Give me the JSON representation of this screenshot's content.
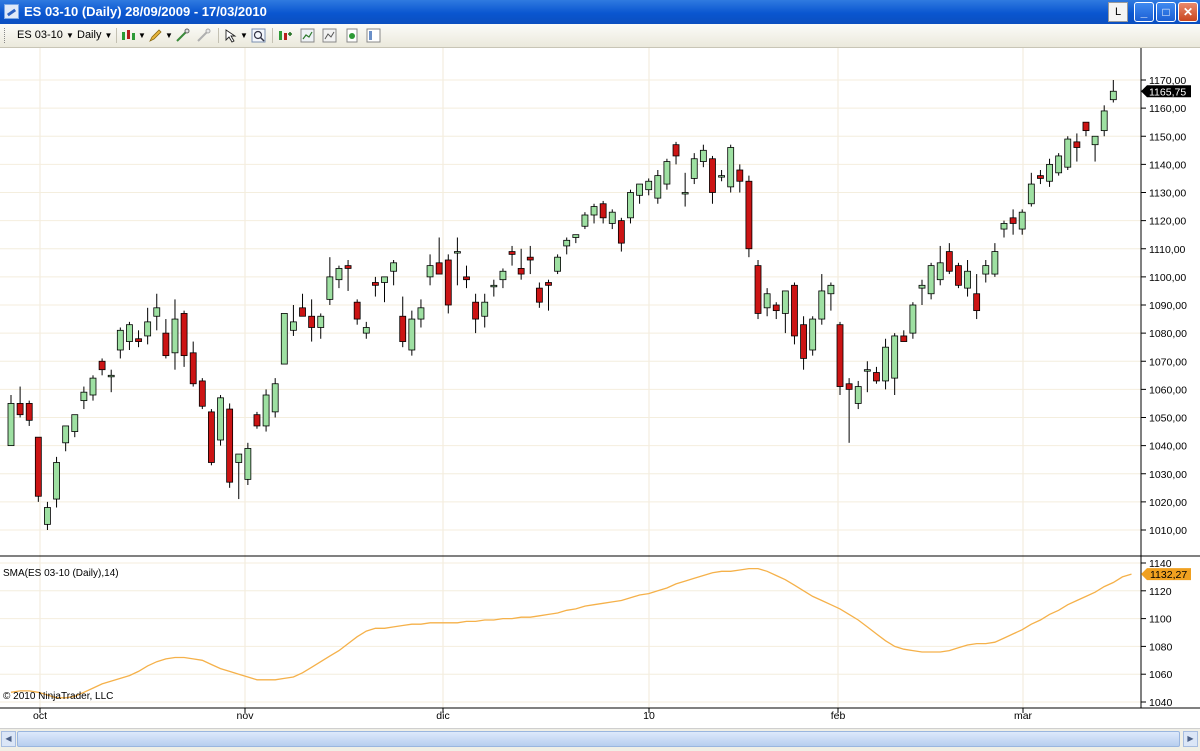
{
  "window": {
    "title": "ES 03-10 (Daily)  28/09/2009 - 17/03/2010",
    "l_button": "L",
    "minimize": "_",
    "maximize": "□",
    "close": "✕"
  },
  "toolbar": {
    "instrument": "ES 03-10",
    "interval": "Daily",
    "icons": [
      "bar-type-icon",
      "pencil-draw-icon",
      "crosshair-icon",
      "stop-icon",
      "pointer-icon",
      "zoom-icon",
      "strategy-icon",
      "indicator-icon",
      "chart-properties-icon",
      "data-box-icon",
      "panel-icon"
    ]
  },
  "colors": {
    "up": "#9ee0a2",
    "down": "#cc1414",
    "sma": "#f5b14a",
    "last_price_bg": "#000000",
    "sma_label_bg": "#f0a020"
  },
  "price_panel": {
    "last_price_label": "1165,75",
    "y_ticks": [
      "1170,00",
      "1160,00",
      "1150,00",
      "1140,00",
      "1130,00",
      "1120,00",
      "1110,00",
      "1100,00",
      "1090,00",
      "1080,00",
      "1070,00",
      "1060,00",
      "1050,00",
      "1040,00",
      "1030,00",
      "1020,00",
      "1010,00"
    ]
  },
  "indicator_panel": {
    "title": "SMA(ES 03-10 (Daily),14)",
    "last_value_label": "1132,27",
    "y_ticks": [
      "1140",
      "1120",
      "1100",
      "1080",
      "1060",
      "1040"
    ]
  },
  "x_axis_labels": [
    "oct",
    "nov",
    "dic",
    "10",
    "feb",
    "mar"
  ],
  "copyright": "© 2010 NinjaTrader, LLC",
  "chart_data": {
    "type": "candlestick",
    "title": "ES 03-10 (Daily)",
    "date_range": "28/09/2009 - 17/03/2010",
    "ylim": [
      1003,
      1173
    ],
    "x_labels": [
      "oct",
      "nov",
      "dic",
      "10",
      "feb",
      "mar"
    ],
    "candles": [
      {
        "o": 1040,
        "h": 1058,
        "l": 1040,
        "c": 1055
      },
      {
        "o": 1055,
        "h": 1061,
        "l": 1050,
        "c": 1051
      },
      {
        "o": 1055,
        "h": 1056,
        "l": 1047,
        "c": 1049
      },
      {
        "o": 1043,
        "h": 1043,
        "l": 1020,
        "c": 1022
      },
      {
        "o": 1012,
        "h": 1020,
        "l": 1010,
        "c": 1018
      },
      {
        "o": 1021,
        "h": 1036,
        "l": 1018,
        "c": 1034
      },
      {
        "o": 1041,
        "h": 1047,
        "l": 1038,
        "c": 1047
      },
      {
        "o": 1045,
        "h": 1051,
        "l": 1043,
        "c": 1051
      },
      {
        "o": 1056,
        "h": 1061,
        "l": 1053,
        "c": 1059
      },
      {
        "o": 1058,
        "h": 1065,
        "l": 1056,
        "c": 1064
      },
      {
        "o": 1070,
        "h": 1071,
        "l": 1065,
        "c": 1067
      },
      {
        "o": 1065,
        "h": 1067,
        "l": 1059,
        "c": 1065
      },
      {
        "o": 1074,
        "h": 1082,
        "l": 1071,
        "c": 1081
      },
      {
        "o": 1077,
        "h": 1084,
        "l": 1074,
        "c": 1083
      },
      {
        "o": 1078,
        "h": 1081,
        "l": 1075,
        "c": 1077
      },
      {
        "o": 1079,
        "h": 1089,
        "l": 1076,
        "c": 1084
      },
      {
        "o": 1086,
        "h": 1094,
        "l": 1081,
        "c": 1089
      },
      {
        "o": 1080,
        "h": 1085,
        "l": 1071,
        "c": 1072
      },
      {
        "o": 1073,
        "h": 1092,
        "l": 1067,
        "c": 1085
      },
      {
        "o": 1087,
        "h": 1088,
        "l": 1068,
        "c": 1072
      },
      {
        "o": 1073,
        "h": 1077,
        "l": 1061,
        "c": 1062
      },
      {
        "o": 1063,
        "h": 1064,
        "l": 1053,
        "c": 1054
      },
      {
        "o": 1052,
        "h": 1053,
        "l": 1033,
        "c": 1034
      },
      {
        "o": 1042,
        "h": 1058,
        "l": 1040,
        "c": 1057
      },
      {
        "o": 1053,
        "h": 1055,
        "l": 1025,
        "c": 1027
      },
      {
        "o": 1034,
        "h": 1037,
        "l": 1021,
        "c": 1037
      },
      {
        "o": 1028,
        "h": 1041,
        "l": 1026,
        "c": 1039
      },
      {
        "o": 1051,
        "h": 1052,
        "l": 1046,
        "c": 1047
      },
      {
        "o": 1047,
        "h": 1060,
        "l": 1045,
        "c": 1058
      },
      {
        "o": 1052,
        "h": 1064,
        "l": 1050,
        "c": 1062
      },
      {
        "o": 1069,
        "h": 1087,
        "l": 1069,
        "c": 1087
      },
      {
        "o": 1081,
        "h": 1090,
        "l": 1079,
        "c": 1084
      },
      {
        "o": 1089,
        "h": 1094,
        "l": 1086,
        "c": 1086
      },
      {
        "o": 1086,
        "h": 1092,
        "l": 1077,
        "c": 1082
      },
      {
        "o": 1082,
        "h": 1087,
        "l": 1078,
        "c": 1086
      },
      {
        "o": 1092,
        "h": 1107,
        "l": 1090,
        "c": 1100
      },
      {
        "o": 1099,
        "h": 1104,
        "l": 1096,
        "c": 1103
      },
      {
        "o": 1104,
        "h": 1106,
        "l": 1095,
        "c": 1103
      },
      {
        "o": 1091,
        "h": 1092,
        "l": 1083,
        "c": 1085
      },
      {
        "o": 1080,
        "h": 1084,
        "l": 1078,
        "c": 1082
      },
      {
        "o": 1098,
        "h": 1100,
        "l": 1093,
        "c": 1097
      },
      {
        "o": 1098,
        "h": 1100,
        "l": 1091,
        "c": 1100
      },
      {
        "o": 1102,
        "h": 1106,
        "l": 1097,
        "c": 1105
      },
      {
        "o": 1086,
        "h": 1093,
        "l": 1075,
        "c": 1077
      },
      {
        "o": 1074,
        "h": 1088,
        "l": 1072,
        "c": 1085
      },
      {
        "o": 1085,
        "h": 1092,
        "l": 1082,
        "c": 1089
      },
      {
        "o": 1100,
        "h": 1108,
        "l": 1097,
        "c": 1104
      },
      {
        "o": 1105,
        "h": 1114,
        "l": 1101,
        "c": 1101
      },
      {
        "o": 1106,
        "h": 1108,
        "l": 1087,
        "c": 1090
      },
      {
        "o": 1109,
        "h": 1114,
        "l": 1097,
        "c": 1109
      },
      {
        "o": 1100,
        "h": 1104,
        "l": 1096,
        "c": 1099
      },
      {
        "o": 1091,
        "h": 1094,
        "l": 1080,
        "c": 1085
      },
      {
        "o": 1086,
        "h": 1094,
        "l": 1082,
        "c": 1091
      },
      {
        "o": 1097,
        "h": 1099,
        "l": 1093,
        "c": 1097
      },
      {
        "o": 1099,
        "h": 1103,
        "l": 1096,
        "c": 1102
      },
      {
        "o": 1109,
        "h": 1111,
        "l": 1104,
        "c": 1108
      },
      {
        "o": 1103,
        "h": 1110,
        "l": 1099,
        "c": 1101
      },
      {
        "o": 1107,
        "h": 1111,
        "l": 1101,
        "c": 1106
      },
      {
        "o": 1096,
        "h": 1098,
        "l": 1089,
        "c": 1091
      },
      {
        "o": 1098,
        "h": 1099,
        "l": 1088,
        "c": 1097
      },
      {
        "o": 1102,
        "h": 1108,
        "l": 1101,
        "c": 1107
      },
      {
        "o": 1111,
        "h": 1114,
        "l": 1108,
        "c": 1113
      },
      {
        "o": 1114,
        "h": 1115,
        "l": 1112,
        "c": 1115
      },
      {
        "o": 1118,
        "h": 1123,
        "l": 1117,
        "c": 1122
      },
      {
        "o": 1122,
        "h": 1126,
        "l": 1119,
        "c": 1125
      },
      {
        "o": 1126,
        "h": 1127,
        "l": 1119,
        "c": 1121
      },
      {
        "o": 1119,
        "h": 1124,
        "l": 1117,
        "c": 1123
      },
      {
        "o": 1120,
        "h": 1121,
        "l": 1109,
        "c": 1112
      },
      {
        "o": 1121,
        "h": 1131,
        "l": 1119,
        "c": 1130
      },
      {
        "o": 1129,
        "h": 1133,
        "l": 1126,
        "c": 1133
      },
      {
        "o": 1131,
        "h": 1135,
        "l": 1129,
        "c": 1134
      },
      {
        "o": 1128,
        "h": 1138,
        "l": 1126,
        "c": 1136
      },
      {
        "o": 1133,
        "h": 1142,
        "l": 1131,
        "c": 1141
      },
      {
        "o": 1147,
        "h": 1148,
        "l": 1140,
        "c": 1143
      },
      {
        "o": 1130,
        "h": 1137,
        "l": 1125,
        "c": 1130
      },
      {
        "o": 1135,
        "h": 1144,
        "l": 1133,
        "c": 1142
      },
      {
        "o": 1141,
        "h": 1147,
        "l": 1139,
        "c": 1145
      },
      {
        "o": 1142,
        "h": 1143,
        "l": 1126,
        "c": 1130
      },
      {
        "o": 1136,
        "h": 1138,
        "l": 1134,
        "c": 1136
      },
      {
        "o": 1132,
        "h": 1147,
        "l": 1130,
        "c": 1146
      },
      {
        "o": 1138,
        "h": 1140,
        "l": 1130,
        "c": 1134
      },
      {
        "o": 1134,
        "h": 1136,
        "l": 1107,
        "c": 1110
      },
      {
        "o": 1104,
        "h": 1106,
        "l": 1085,
        "c": 1087
      },
      {
        "o": 1089,
        "h": 1096,
        "l": 1086,
        "c": 1094
      },
      {
        "o": 1090,
        "h": 1091,
        "l": 1085,
        "c": 1088
      },
      {
        "o": 1087,
        "h": 1095,
        "l": 1080,
        "c": 1095
      },
      {
        "o": 1097,
        "h": 1098,
        "l": 1076,
        "c": 1079
      },
      {
        "o": 1083,
        "h": 1086,
        "l": 1067,
        "c": 1071
      },
      {
        "o": 1074,
        "h": 1086,
        "l": 1072,
        "c": 1085
      },
      {
        "o": 1085,
        "h": 1101,
        "l": 1083,
        "c": 1095
      },
      {
        "o": 1094,
        "h": 1098,
        "l": 1088,
        "c": 1097
      },
      {
        "o": 1083,
        "h": 1084,
        "l": 1058,
        "c": 1061
      },
      {
        "o": 1062,
        "h": 1064,
        "l": 1041,
        "c": 1060
      },
      {
        "o": 1055,
        "h": 1063,
        "l": 1053,
        "c": 1061
      },
      {
        "o": 1067,
        "h": 1070,
        "l": 1059,
        "c": 1067
      },
      {
        "o": 1066,
        "h": 1068,
        "l": 1062,
        "c": 1063
      },
      {
        "o": 1063,
        "h": 1078,
        "l": 1060,
        "c": 1075
      },
      {
        "o": 1064,
        "h": 1080,
        "l": 1058,
        "c": 1079
      },
      {
        "o": 1079,
        "h": 1081,
        "l": 1077,
        "c": 1077
      },
      {
        "o": 1080,
        "h": 1091,
        "l": 1078,
        "c": 1090
      },
      {
        "o": 1096,
        "h": 1099,
        "l": 1090,
        "c": 1097
      },
      {
        "o": 1094,
        "h": 1105,
        "l": 1092,
        "c": 1104
      },
      {
        "o": 1099,
        "h": 1111,
        "l": 1097,
        "c": 1105
      },
      {
        "o": 1109,
        "h": 1112,
        "l": 1101,
        "c": 1102
      },
      {
        "o": 1104,
        "h": 1105,
        "l": 1096,
        "c": 1097
      },
      {
        "o": 1096,
        "h": 1106,
        "l": 1093,
        "c": 1102
      },
      {
        "o": 1094,
        "h": 1101,
        "l": 1085,
        "c": 1088
      },
      {
        "o": 1101,
        "h": 1106,
        "l": 1098,
        "c": 1104
      },
      {
        "o": 1101,
        "h": 1112,
        "l": 1100,
        "c": 1109
      },
      {
        "o": 1117,
        "h": 1120,
        "l": 1114,
        "c": 1119
      },
      {
        "o": 1121,
        "h": 1124,
        "l": 1115,
        "c": 1119
      },
      {
        "o": 1117,
        "h": 1124,
        "l": 1115,
        "c": 1123
      },
      {
        "o": 1126,
        "h": 1137,
        "l": 1125,
        "c": 1133
      },
      {
        "o": 1136,
        "h": 1138,
        "l": 1133,
        "c": 1135
      },
      {
        "o": 1134,
        "h": 1142,
        "l": 1132,
        "c": 1140
      },
      {
        "o": 1137,
        "h": 1144,
        "l": 1136,
        "c": 1143
      },
      {
        "o": 1139,
        "h": 1150,
        "l": 1138,
        "c": 1149
      },
      {
        "o": 1148,
        "h": 1151,
        "l": 1141,
        "c": 1146
      },
      {
        "o": 1155,
        "h": 1155,
        "l": 1150,
        "c": 1152
      },
      {
        "o": 1147,
        "h": 1149,
        "l": 1141,
        "c": 1150
      },
      {
        "o": 1152,
        "h": 1161,
        "l": 1150,
        "c": 1159
      },
      {
        "o": 1163,
        "h": 1170,
        "l": 1162,
        "c": 1166
      }
    ],
    "sma": {
      "name": "SMA(ES 03-10 (Daily),14)",
      "ylim": [
        1040,
        1143
      ],
      "values": [
        1047,
        1048,
        1048,
        1047,
        1045,
        1043,
        1043,
        1044,
        1047,
        1050,
        1053,
        1055,
        1057,
        1059,
        1062,
        1066,
        1069,
        1071,
        1072,
        1072,
        1071,
        1070,
        1067,
        1064,
        1062,
        1060,
        1058,
        1056,
        1056,
        1056,
        1057,
        1058,
        1061,
        1065,
        1069,
        1073,
        1077,
        1082,
        1087,
        1091,
        1093,
        1093,
        1094,
        1095,
        1096,
        1096,
        1097,
        1097,
        1097,
        1097,
        1098,
        1098,
        1099,
        1099,
        1100,
        1100,
        1101,
        1101,
        1102,
        1103,
        1104,
        1106,
        1107,
        1109,
        1110,
        1111,
        1112,
        1113,
        1115,
        1117,
        1118,
        1120,
        1122,
        1125,
        1127,
        1129,
        1131,
        1133,
        1134,
        1134,
        1135,
        1136,
        1136,
        1134,
        1131,
        1128,
        1124,
        1120,
        1116,
        1113,
        1110,
        1107,
        1103,
        1099,
        1094,
        1089,
        1084,
        1080,
        1078,
        1077,
        1076,
        1076,
        1076,
        1077,
        1079,
        1081,
        1082,
        1082,
        1083,
        1086,
        1089,
        1092,
        1096,
        1099,
        1103,
        1106,
        1110,
        1113,
        1116,
        1119,
        1123,
        1126,
        1130,
        1132
      ]
    }
  }
}
